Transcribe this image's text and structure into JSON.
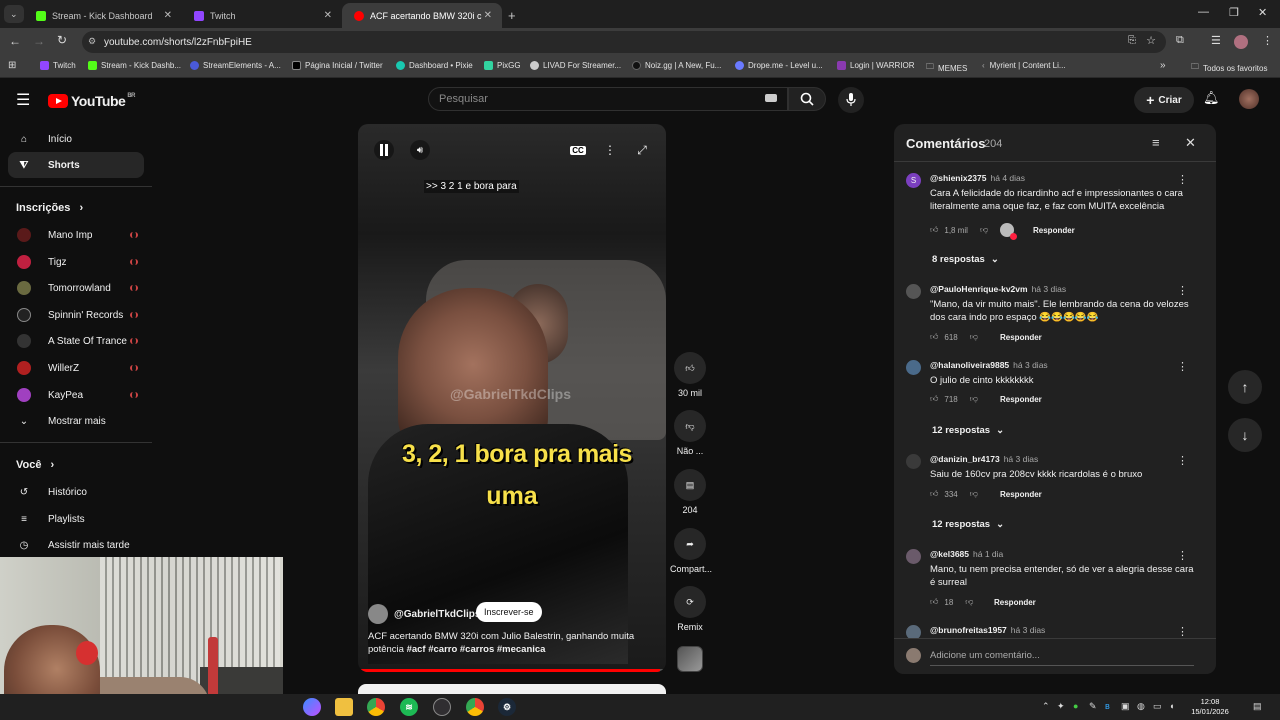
{
  "browser": {
    "tabs": [
      {
        "label": "Stream - Kick Dashboard",
        "color": "#53fc18"
      },
      {
        "label": "Twitch",
        "color": "#9146ff"
      },
      {
        "label": "ACF acertando BMW 320i c",
        "color": "#ff0000"
      }
    ],
    "url": "youtube.com/shorts/l2zFnbFpiHE",
    "bookmarks": [
      "Twitch",
      "Stream - Kick Dashb...",
      "StreamElements - A...",
      "Página Inicial / Twitter",
      "Dashboard • Pixie",
      "PixGG",
      "LIVAD For Streamer...",
      "Noiz.gg | A New, Fu...",
      "Drope.me - Level u...",
      "Login | WARRIOR",
      "MEMES",
      "Myrient | Content Li..."
    ],
    "bookmarks_all": "Todos os favoritos"
  },
  "header": {
    "logo": "YouTube",
    "region": "BR",
    "search_placeholder": "Pesquisar",
    "create_label": "Criar"
  },
  "sidebar": {
    "home": "Início",
    "shorts": "Shorts",
    "subscriptions_title": "Inscrições",
    "channels": [
      {
        "name": "Mano Imp",
        "color": "#5a1a1a"
      },
      {
        "name": "Tigz",
        "color": "#c02040"
      },
      {
        "name": "Tomorrowland",
        "color": "#6a6a40"
      },
      {
        "name": "Spinnin' Records",
        "color": "#222222"
      },
      {
        "name": "A State Of Trance",
        "color": "#333333"
      },
      {
        "name": "WillerZ",
        "color": "#b02020"
      },
      {
        "name": "KayPea",
        "color": "#a040c0"
      }
    ],
    "show_more": "Mostrar mais",
    "you_title": "Você",
    "history": "Histórico",
    "playlists": "Playlists",
    "watch_later": "Assistir mais tarde"
  },
  "video": {
    "subtitle": ">> 3 2 1 e bora para",
    "caption_line1": "3, 2, 1  bora pra mais",
    "caption_line2": "uma",
    "watermark": "@GabrielTkdClips",
    "channel": "@GabrielTkdClips",
    "subscribe": "Inscrever-se",
    "description": "ACF acertando BMW 320i com Julio Balestrin, ganhando muita potência",
    "hashtags": "#acf #carro #carros #mecanica",
    "progress": 0.98
  },
  "actions": {
    "likes": "30 mil",
    "dislike": "Não ...",
    "comments": "204",
    "share": "Compart...",
    "remix": "Remix"
  },
  "comments": {
    "title": "Comentários",
    "count": "204",
    "input_placeholder": "Adicione um comentário...",
    "reply_label": "Responder",
    "items": [
      {
        "author": "@shienix2375",
        "time": "há 4 dias",
        "text": "Cara A felicidade do ricardinho acf e impressionantes o cara literalmente ama oque faz, e faz com MUITA excelência",
        "likes": "1,8 mil",
        "replies": "8 respostas",
        "avatar_letter": "S",
        "avatar_color": "#7b3fbf"
      },
      {
        "author": "@PauloHenrique-kv2vm",
        "time": "há 3 dias",
        "text": "\"Mano, da vir muito mais\". Ele lembrando da cena do velozes dos cara indo pro espaço 😂😂😂😂😂",
        "likes": "618",
        "replies": "",
        "avatar_color": "#555555"
      },
      {
        "author": "@halanoliveira9885",
        "time": "há 3 dias",
        "text": "O julio de cinto kkkkkkkk",
        "likes": "718",
        "replies": "12 respostas",
        "avatar_color": "#4a6a8a"
      },
      {
        "author": "@danizin_br4173",
        "time": "há 3 dias",
        "text": "Saiu de 160cv pra 208cv kkkk ricardolas é o bruxo",
        "likes": "334",
        "replies": "12 respostas",
        "avatar_color": "#3a3a3a"
      },
      {
        "author": "@kel3685",
        "time": "há 1 dia",
        "text": "Mano, tu nem precisa entender, só de ver a alegria desse cara é surreal",
        "likes": "18",
        "replies": "",
        "avatar_color": "#6a5a6a"
      },
      {
        "author": "@brunofreitas1957",
        "time": "há 3 dias",
        "text": "",
        "likes": "",
        "replies": "",
        "avatar_color": "#5a6a7a"
      }
    ]
  },
  "taskbar": {
    "time": "12:08",
    "date": "15/01/2026"
  }
}
